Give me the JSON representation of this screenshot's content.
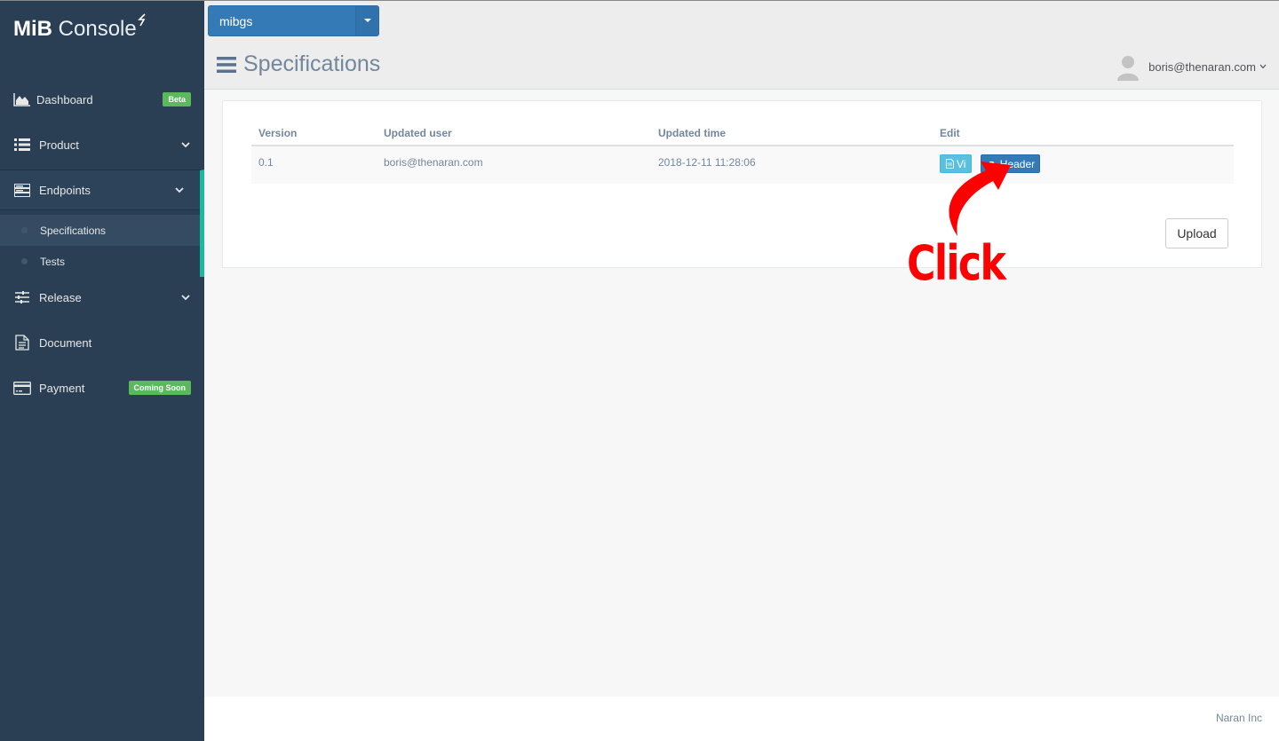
{
  "app": {
    "logo_bold": "MiB",
    "logo_light": "Console"
  },
  "sidebar": {
    "items": [
      {
        "label": "Dashboard",
        "icon": "area-chart-icon",
        "badge": "Beta"
      },
      {
        "label": "Product",
        "icon": "list-icon"
      },
      {
        "label": "Endpoints",
        "icon": "server-icon"
      },
      {
        "label": "Release",
        "icon": "sliders-icon"
      },
      {
        "label": "Document",
        "icon": "file-text-icon"
      },
      {
        "label": "Payment",
        "icon": "credit-card-icon",
        "badge": "Coming Soon"
      }
    ],
    "subitems": [
      {
        "label": "Specifications"
      },
      {
        "label": "Tests"
      }
    ]
  },
  "header": {
    "project": "mibgs",
    "title": "Specifications",
    "user": "boris@thenaran.com"
  },
  "table": {
    "columns": [
      "Version",
      "Updated user",
      "Updated time",
      "Edit"
    ],
    "rows": [
      {
        "version": "0.1",
        "user": "boris@thenaran.com",
        "time": "2018-12-11 11:28:06",
        "view_label": "Vi",
        "header_label": "Header"
      }
    ]
  },
  "actions": {
    "upload_label": "Upload"
  },
  "annotation": {
    "text": "Click"
  },
  "footer": {
    "text": "Naran Inc"
  },
  "colors": {
    "sidebar_bg": "#2a3f54",
    "accent": "#1abb9c",
    "primary": "#337ab7",
    "info": "#5bc0de",
    "badge": "#5cb85c",
    "annotation": "#ff0000"
  }
}
